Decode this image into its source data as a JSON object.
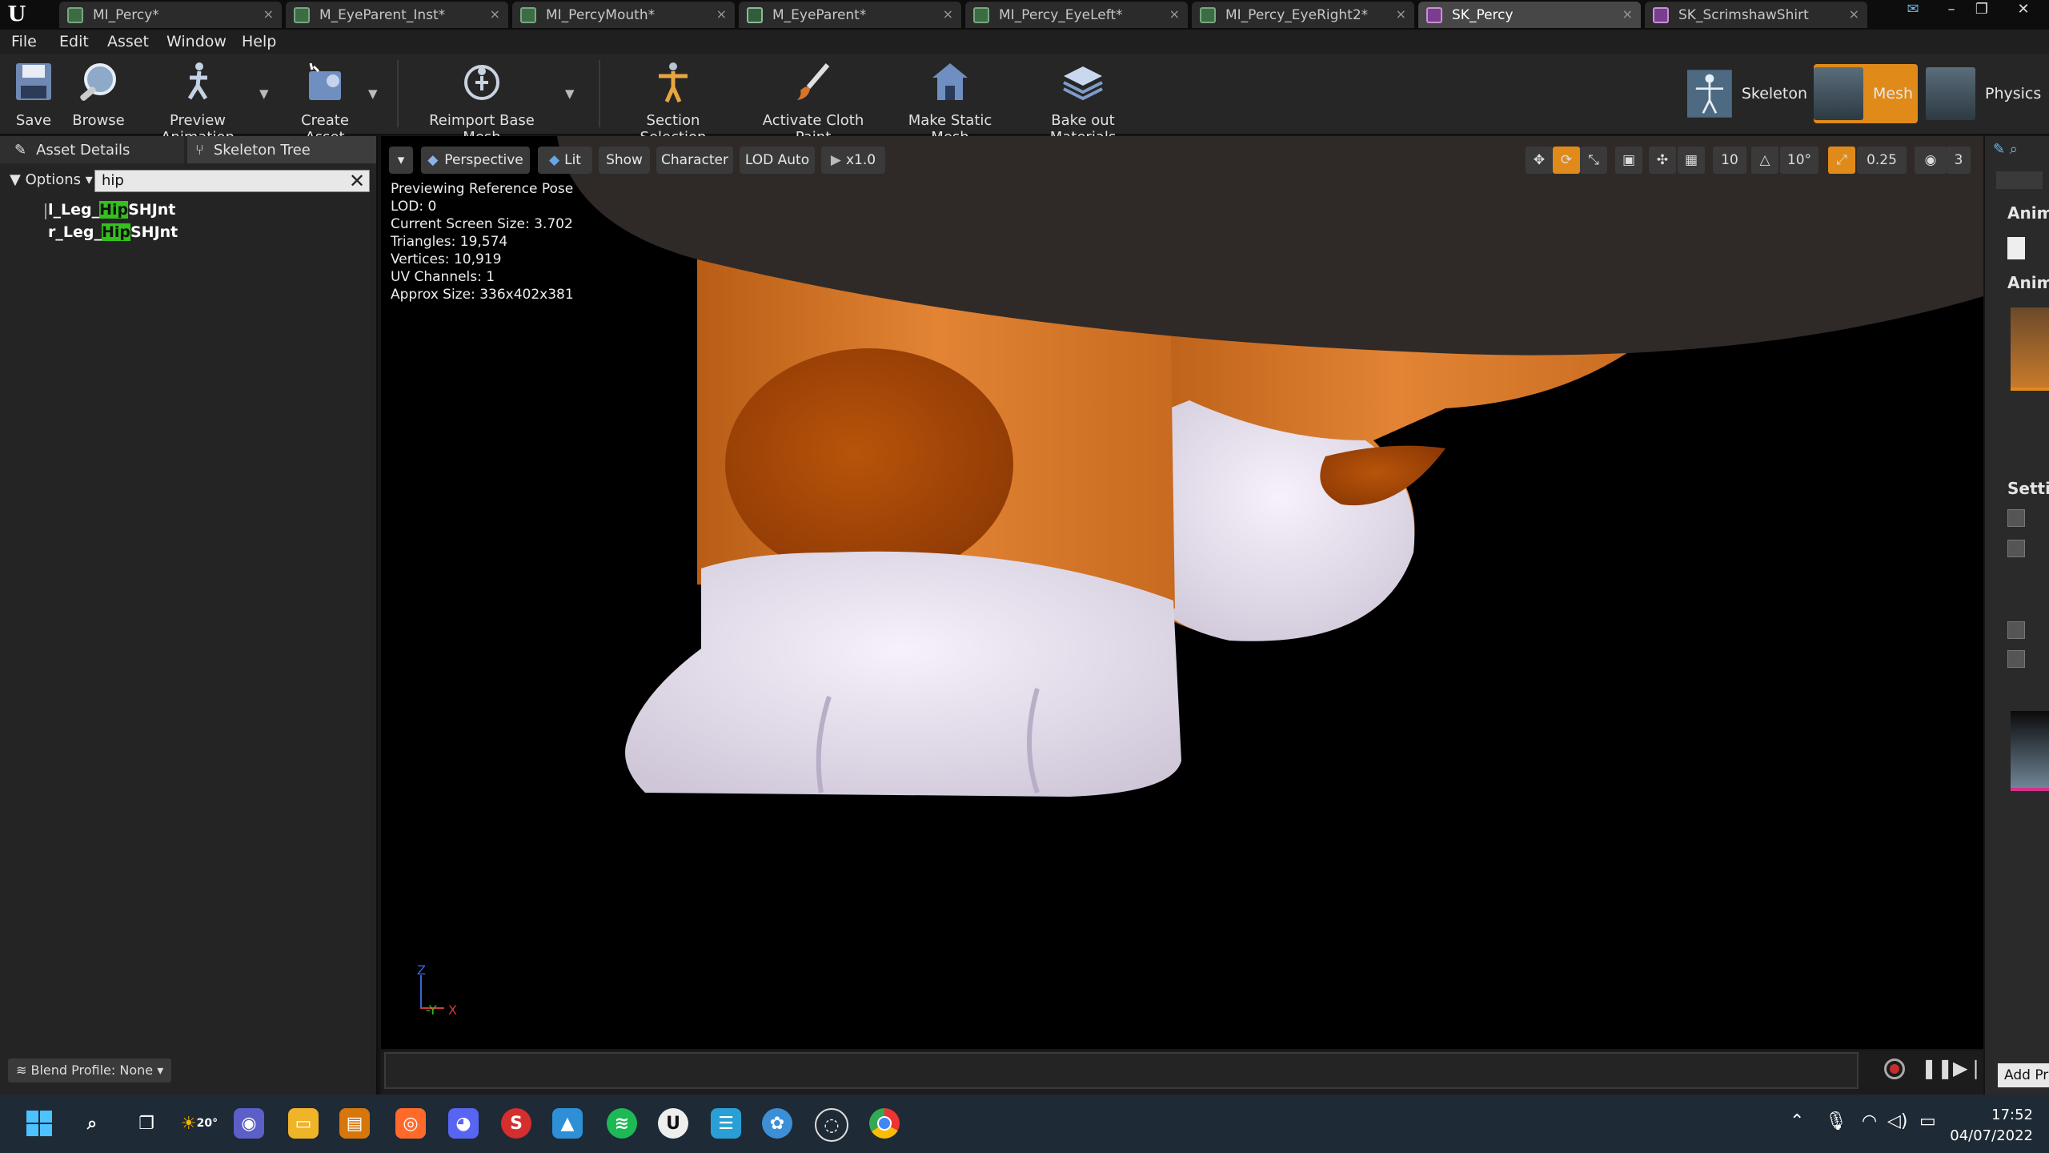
{
  "tabs": [
    {
      "label": "MI_Percy*",
      "icon": "material-instance-icon"
    },
    {
      "label": "M_EyeParent_Inst*",
      "icon": "material-instance-icon"
    },
    {
      "label": "MI_PercyMouth*",
      "icon": "material-instance-icon"
    },
    {
      "label": "M_EyeParent*",
      "icon": "material-icon"
    },
    {
      "label": "MI_Percy_EyeLeft*",
      "icon": "material-instance-icon"
    },
    {
      "label": "MI_Percy_EyeRight2*",
      "icon": "material-instance-icon"
    },
    {
      "label": "SK_Percy",
      "icon": "skeletal-mesh-icon",
      "active": true
    },
    {
      "label": "SK_ScrimshawShirt",
      "icon": "skeletal-mesh-icon"
    }
  ],
  "menu": {
    "items": [
      "File",
      "Edit",
      "Asset",
      "Window",
      "Help"
    ]
  },
  "toolbar": {
    "save": "Save",
    "browse": "Browse",
    "preview_animation": "Preview Animation",
    "create_asset": "Create Asset",
    "reimport": "Reimport Base Mesh",
    "section_selection": "Section Selection",
    "activate_cloth_paint": "Activate Cloth Paint",
    "make_static_mesh": "Make Static Mesh",
    "bake_materials": "Bake out Materials",
    "mode_skeleton": "Skeleton",
    "mode_mesh": "Mesh",
    "mode_physics": "Physics"
  },
  "left_panel": {
    "tab_asset_details": "Asset Details",
    "tab_skeleton_tree": "Skeleton Tree",
    "options": "Options",
    "search_value": "hip",
    "bones": [
      {
        "prefix": "l_Leg_",
        "match": "Hip",
        "suffix": "SHJnt"
      },
      {
        "prefix": "r_Leg_",
        "match": "Hip",
        "suffix": "SHJnt"
      }
    ],
    "blend_profile": "Blend Profile: None"
  },
  "viewport": {
    "perspective": "Perspective",
    "lit": "Lit",
    "show": "Show",
    "character": "Character",
    "lod": "LOD Auto",
    "speed": "x1.0",
    "grid_snap": "10",
    "rot_snap": "10°",
    "scale_snap": "0.25",
    "cam_speed": "3",
    "stats": [
      "Previewing Reference Pose",
      "LOD: 0",
      "Current Screen Size: 3.702",
      "Triangles: 19,574",
      "Vertices: 10,919",
      "UV Channels: 1",
      "Approx Size: 336x402x381"
    ],
    "axis_z": "Z",
    "axis_y": "-Y",
    "axis_x": "X"
  },
  "right_panel": {
    "anim1": "Anim",
    "anim2": "Anim",
    "settings": "Settir",
    "add": "Add Pr"
  },
  "taskbar": {
    "weather": "20°",
    "time": "17:52",
    "date": "04/07/2022"
  },
  "colors": {
    "mesh_mode_accent": "#e08a1a",
    "search_highlight": "#34c01d",
    "fur_orange": "#d5741c",
    "fur_white": "#efe9f3"
  }
}
